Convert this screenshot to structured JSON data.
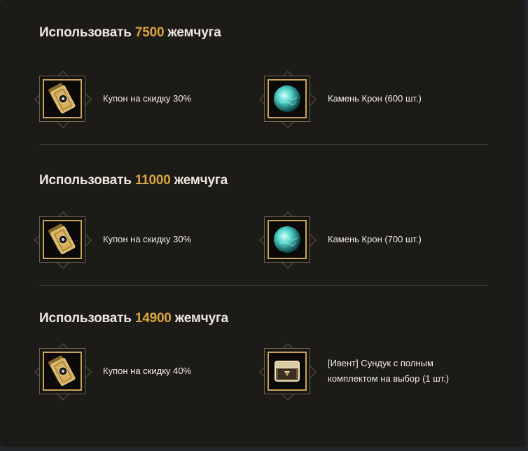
{
  "sections": [
    {
      "title_prefix": "Использовать",
      "amount": "7500",
      "title_suffix": "жемчуга",
      "rewards": [
        {
          "label": "Купон на скидку 30%",
          "icon": "discount-coupon-icon"
        },
        {
          "label": "Камень Крон (600 шт.)",
          "icon": "crown-stone-icon"
        }
      ]
    },
    {
      "title_prefix": "Использовать",
      "amount": "11000",
      "title_suffix": "жемчуга",
      "rewards": [
        {
          "label": "Купон на скидку 30%",
          "icon": "discount-coupon-icon"
        },
        {
          "label": "Камень Крон (700 шт.)",
          "icon": "crown-stone-icon"
        }
      ]
    },
    {
      "title_prefix": "Использовать",
      "amount": "14900",
      "title_suffix": "жемчуга",
      "rewards": [
        {
          "label": "Купон на скидку 40%",
          "icon": "discount-coupon-icon"
        },
        {
          "label_line1": "[Ивент] Сундук с полным",
          "label_line2": "комплектом на выбор (1 шт.)",
          "icon": "treasure-chest-icon"
        }
      ]
    }
  ],
  "colors": {
    "accent": "#d7a53e",
    "title": "#ece8df",
    "background": "#1d1b17",
    "frame": "#c9a35a"
  }
}
